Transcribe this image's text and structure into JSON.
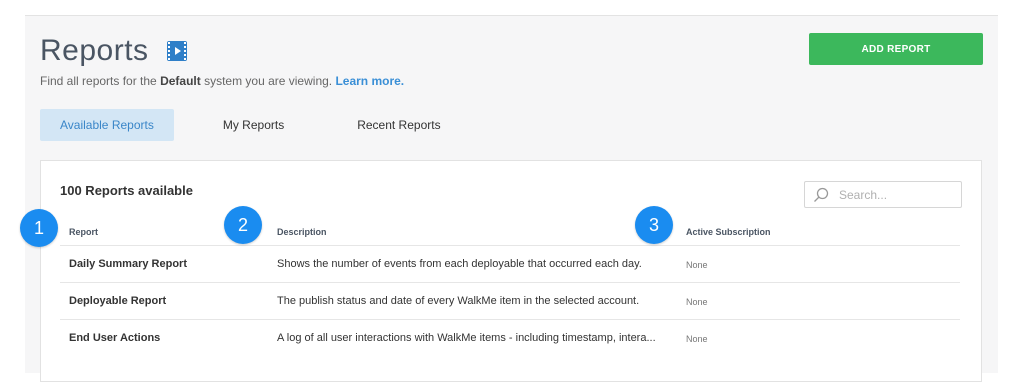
{
  "header": {
    "title": "Reports",
    "subtitle_prefix": "Find all reports for the ",
    "system_name": "Default",
    "subtitle_middle": " system you are viewing. ",
    "learn_more": "Learn more.",
    "add_button": "ADD REPORT"
  },
  "tabs": [
    {
      "label": "Available Reports",
      "active": true
    },
    {
      "label": "My Reports",
      "active": false
    },
    {
      "label": "Recent Reports",
      "active": false
    }
  ],
  "card": {
    "count_label": "100 Reports available",
    "search_placeholder": "Search...",
    "columns": {
      "report": "Report",
      "description": "Description",
      "subscription": "Active Subscription"
    },
    "rows": [
      {
        "name": "Daily Summary Report",
        "description": "Shows the number of events from each deployable that occurred each day.",
        "subscription": "None"
      },
      {
        "name": "Deployable Report",
        "description": "The publish status and date of every WalkMe item in the selected account.",
        "subscription": "None"
      },
      {
        "name": "End User Actions",
        "description": "A log of all user interactions with WalkMe items - including timestamp, intera...",
        "subscription": "None"
      }
    ]
  },
  "badges": [
    "1",
    "2",
    "3"
  ],
  "colors": {
    "accent_green": "#3cb85c",
    "link_blue": "#3a8fd6",
    "badge_blue": "#1a8cf0",
    "tab_active_bg": "#d3e6f5"
  },
  "icons": {
    "video": "video-icon",
    "search": "search-icon"
  }
}
